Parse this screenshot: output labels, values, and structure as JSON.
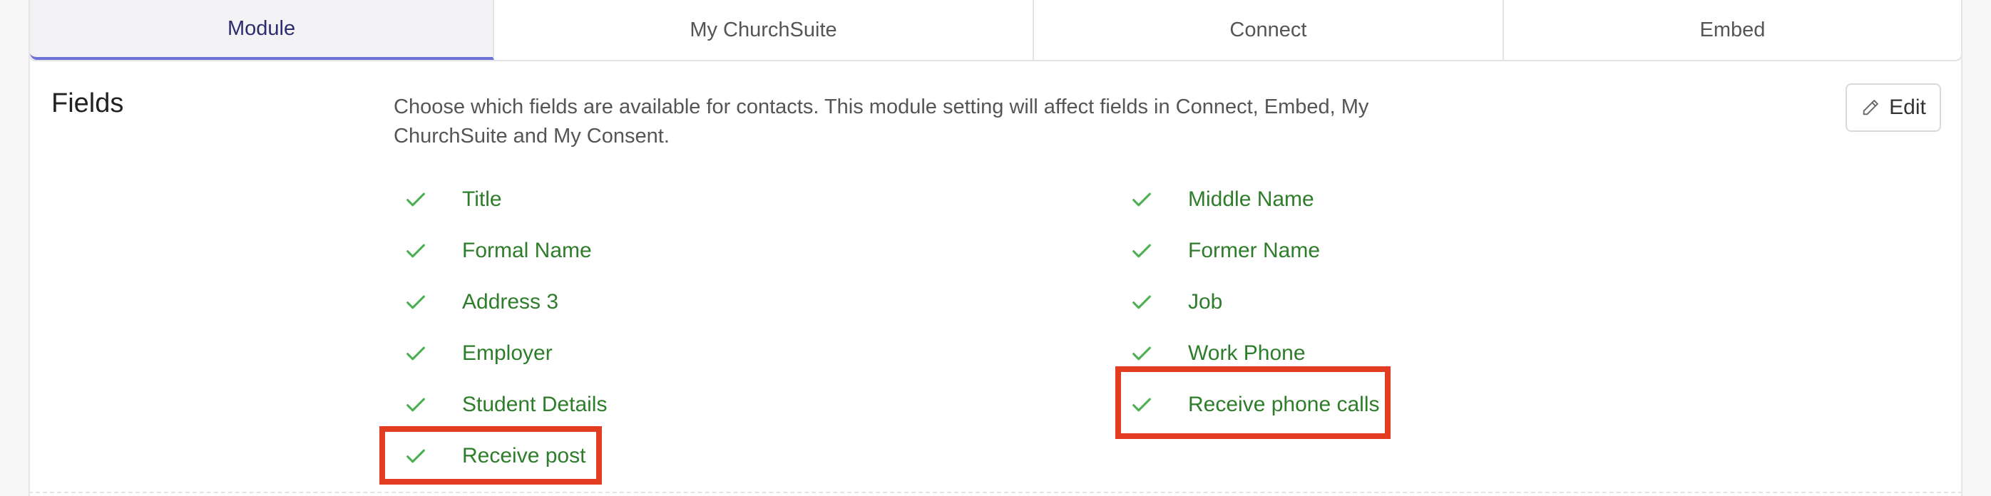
{
  "tabs": [
    {
      "label": "Module",
      "active": true
    },
    {
      "label": "My ChurchSuite",
      "active": false
    },
    {
      "label": "Connect",
      "active": false
    },
    {
      "label": "Embed",
      "active": false
    }
  ],
  "section": {
    "title": "Fields",
    "description": "Choose which fields are available for contacts. This module setting will affect fields in Connect, Embed, My ChurchSuite and My Consent.",
    "edit_label": "Edit"
  },
  "fields": {
    "left": [
      "Title",
      "Formal Name",
      "Address 3",
      "Employer",
      "Student Details",
      "Receive post"
    ],
    "right": [
      "Middle Name",
      "Former Name",
      "Job",
      "Work Phone",
      "Receive phone calls"
    ]
  },
  "icons": {
    "check": "check-icon",
    "edit": "pencil-icon"
  },
  "colors": {
    "accent": "#6c72d6",
    "enabled_field": "#2e7d2a",
    "check": "#4caf50",
    "highlight": "#e23d22"
  }
}
